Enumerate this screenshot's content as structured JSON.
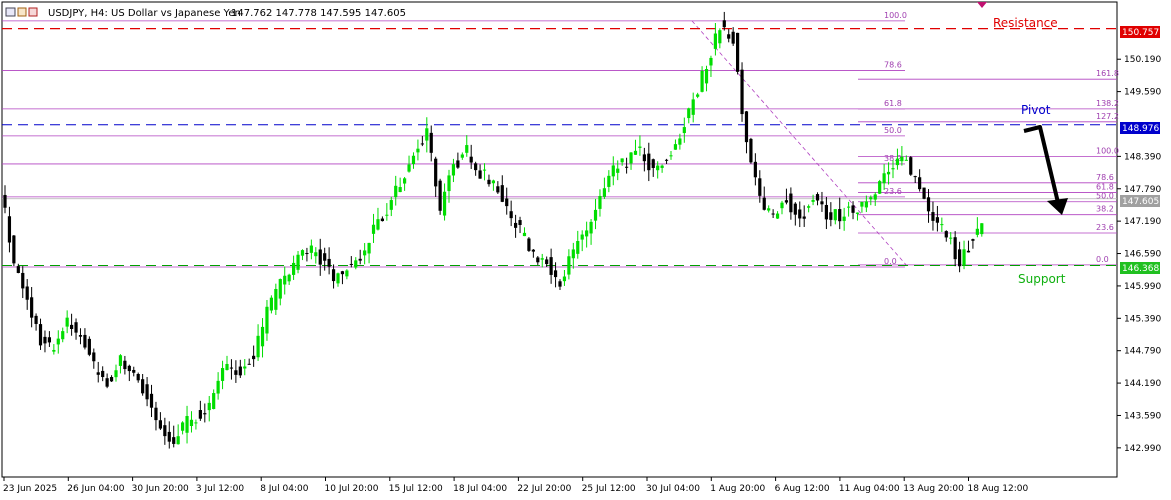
{
  "header": {
    "title": "USDJPY, H4:  US Dollar vs Japanese Yen",
    "ohlc": "147.762 147.778 147.595 147.605"
  },
  "colors": {
    "bull": "#00dd00",
    "bear": "#000000",
    "fib": "#b040c0",
    "resistance": "#e00000",
    "pivot": "#0000cc",
    "support": "#00a000",
    "price_tag": "#a0a0a0"
  },
  "annotations": {
    "resistance_label": "Resistance",
    "pivot_label": "Pivot",
    "support_label": "Support"
  },
  "price_tags": {
    "resistance": "150.757",
    "pivot": "148.976",
    "current": "147.605",
    "support": "146.368"
  },
  "chart_data": {
    "type": "candlestick",
    "symbol": "USDJPY",
    "timeframe": "H4",
    "ylim": [
      142.45,
      151.25
    ],
    "y_ticks": [
      "150.190",
      "149.590",
      "148.390",
      "147.790",
      "147.190",
      "146.590",
      "145.990",
      "145.390",
      "144.790",
      "144.190",
      "143.590",
      "142.990"
    ],
    "x_ticks": [
      "23 Jun 2025",
      "26 Jun 04:00",
      "30 Jun 20:00",
      "3 Jul 12:00",
      "8 Jul 04:00",
      "10 Jul 20:00",
      "15 Jul 12:00",
      "18 Jul 04:00",
      "22 Jul 20:00",
      "25 Jul 12:00",
      "30 Jul 04:00",
      "1 Aug 20:00",
      "6 Aug 12:00",
      "11 Aug 04:00",
      "13 Aug 20:00",
      "18 Aug 12:00"
    ],
    "horizontal_levels": {
      "resistance": 150.757,
      "pivot": 148.976,
      "support": 146.368,
      "current": 147.605
    },
    "fib_retracement": [
      {
        "label": "100.0",
        "value": 150.9
      },
      {
        "label": "78.6",
        "value": 149.98
      },
      {
        "label": "61.8",
        "value": 149.27
      },
      {
        "label": "50.0",
        "value": 148.77
      },
      {
        "label": "38.2",
        "value": 148.25
      },
      {
        "label": "23.6",
        "value": 147.64
      },
      {
        "label": "0.0",
        "value": 146.34
      }
    ],
    "fib_expansion": [
      {
        "label": "161.8",
        "value": 149.82
      },
      {
        "label": "138.2",
        "value": 149.27
      },
      {
        "label": "127.2",
        "value": 149.03
      },
      {
        "label": "100.0",
        "value": 148.39
      },
      {
        "label": "78.6",
        "value": 147.9
      },
      {
        "label": "61.8",
        "value": 147.72
      },
      {
        "label": "50.0",
        "value": 147.55
      },
      {
        "label": "38.2",
        "value": 147.31
      },
      {
        "label": "23.6",
        "value": 146.97
      },
      {
        "label": "0.0",
        "value": 146.38
      }
    ],
    "closes": [
      147.8,
      146.4,
      145.7,
      145.0,
      144.8,
      145.3,
      145.1,
      144.5,
      144.2,
      144.6,
      144.4,
      143.9,
      143.3,
      143.1,
      143.5,
      143.6,
      143.9,
      144.6,
      144.4,
      144.7,
      145.5,
      146.0,
      146.4,
      146.7,
      146.5,
      146.1,
      146.3,
      146.5,
      147.0,
      147.4,
      147.9,
      148.4,
      148.9,
      147.4,
      148.2,
      148.5,
      148.1,
      147.9,
      147.4,
      147.0,
      146.6,
      146.4,
      146.1,
      146.6,
      147.0,
      147.6,
      148.1,
      148.3,
      148.5,
      148.1,
      148.3,
      148.8,
      149.4,
      150.1,
      150.8,
      150.6,
      148.6,
      147.6,
      147.3,
      147.6,
      147.2,
      147.6,
      147.3,
      147.3,
      147.4,
      147.6,
      147.9,
      148.2,
      148.3,
      147.8,
      147.3,
      147.0,
      146.4,
      146.9,
      147.4,
      147.3,
      147.6,
      147.8,
      147.605
    ]
  }
}
